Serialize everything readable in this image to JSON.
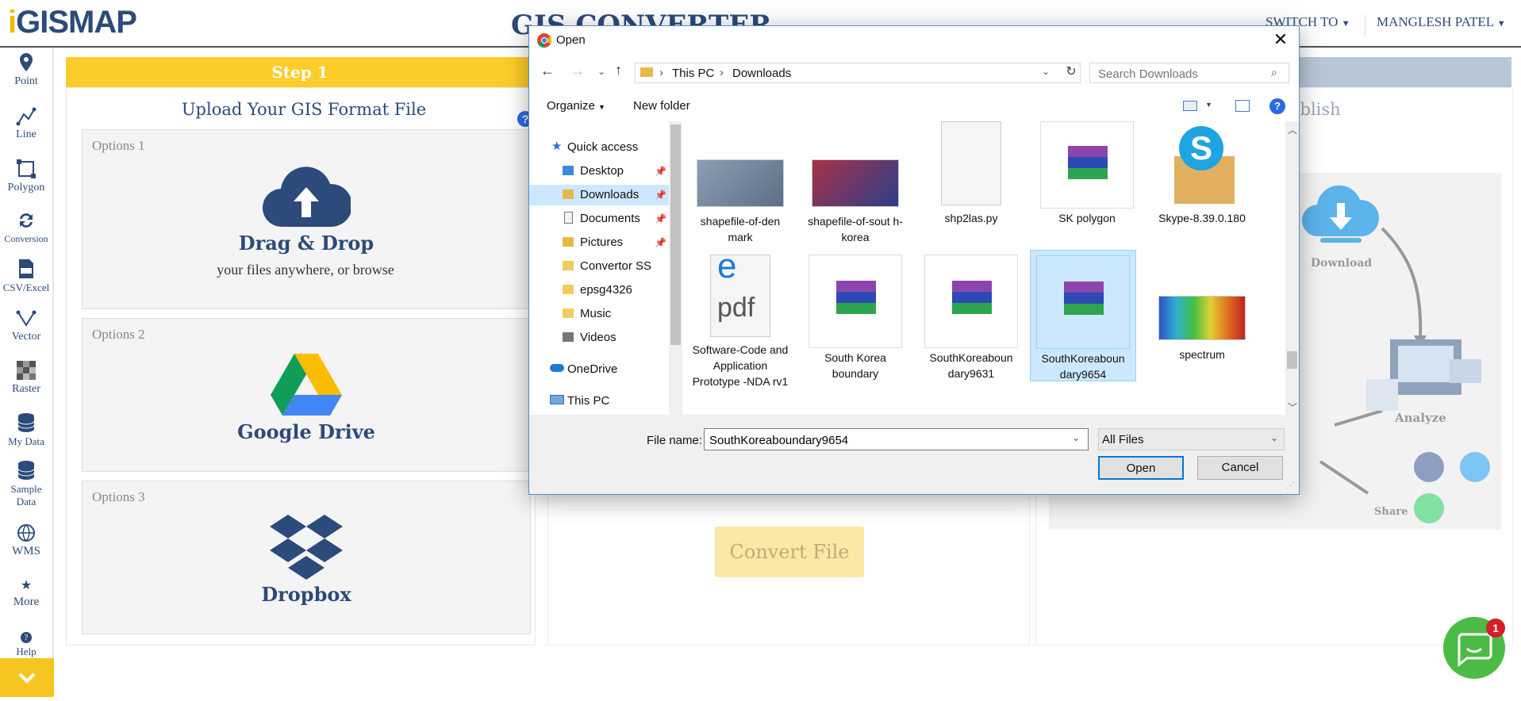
{
  "header": {
    "logo_prefix": "i",
    "logo_text": "GISMAP",
    "title": "GIS CONVERTER",
    "switch_to": "SWITCH TO",
    "user": "MANGLESH PATEL"
  },
  "sidebar": {
    "items": [
      {
        "label": "Point",
        "icon": "point-icon"
      },
      {
        "label": "Line",
        "icon": "line-icon"
      },
      {
        "label": "Polygon",
        "icon": "polygon-icon"
      },
      {
        "label": "Conversion",
        "icon": "conversion-icon"
      },
      {
        "label": "CSV/Excel",
        "icon": "csv-icon"
      },
      {
        "label": "Vector",
        "icon": "vector-icon"
      },
      {
        "label": "Raster",
        "icon": "raster-icon"
      },
      {
        "label": "My Data",
        "icon": "database-icon"
      },
      {
        "label": "Sample Data",
        "icon": "sample-data-icon"
      },
      {
        "label": "WMS",
        "icon": "wms-icon"
      },
      {
        "label": "More",
        "icon": "star-icon"
      },
      {
        "label": "Help",
        "icon": "help-icon"
      }
    ]
  },
  "main": {
    "step1_label": "Step 1",
    "upload_title": "Upload Your GIS Format File",
    "options": [
      {
        "label": "Options 1",
        "title": "Drag & Drop",
        "subtitle": "your files anywhere, or browse"
      },
      {
        "label": "Options 2",
        "title": "Google Drive"
      },
      {
        "label": "Options 3",
        "title": "Dropbox"
      }
    ],
    "publish_label": "ublish",
    "convert_button": "Convert File",
    "graphic_labels": {
      "download": "Download",
      "analyze": "Analyze",
      "share": "Share"
    }
  },
  "chat": {
    "badge": "1"
  },
  "dialog": {
    "title": "Open",
    "breadcrumb": [
      "This PC",
      "Downloads"
    ],
    "search_placeholder": "Search Downloads",
    "organize": "Organize",
    "new_folder": "New folder",
    "nav": [
      {
        "label": "Quick access",
        "icon": "star-icon"
      },
      {
        "label": "Desktop",
        "icon": "folder-icon",
        "pinned": true
      },
      {
        "label": "Downloads",
        "icon": "download-folder-icon",
        "pinned": true,
        "selected": true
      },
      {
        "label": "Documents",
        "icon": "documents-icon",
        "pinned": true
      },
      {
        "label": "Pictures",
        "icon": "pictures-icon",
        "pinned": true
      },
      {
        "label": "Convertor SS",
        "icon": "folder-icon"
      },
      {
        "label": "epsg4326",
        "icon": "folder-icon"
      },
      {
        "label": "Music",
        "icon": "music-icon"
      },
      {
        "label": "Videos",
        "icon": "videos-icon"
      },
      {
        "label": "OneDrive",
        "icon": "onedrive-icon"
      },
      {
        "label": "This PC",
        "icon": "computer-icon"
      }
    ],
    "files": [
      {
        "name": "shapefile-of-den mark",
        "kind": "image",
        "selected": false
      },
      {
        "name": "shapefile-of-sout h-korea",
        "kind": "image",
        "selected": false
      },
      {
        "name": "shp2las.py",
        "kind": "blank",
        "selected": false
      },
      {
        "name": "SK polygon",
        "kind": "archive",
        "selected": false
      },
      {
        "name": "Skype-8.39.0.180",
        "kind": "skype",
        "selected": false
      },
      {
        "name": "Software-Code and Application Prototype -NDA rv1",
        "kind": "pdf",
        "selected": false
      },
      {
        "name": "South Korea boundary",
        "kind": "archive",
        "selected": false
      },
      {
        "name": "SouthKoreaboun dary9631",
        "kind": "archive",
        "selected": false
      },
      {
        "name": "SouthKoreaboun dary9654",
        "kind": "archive",
        "selected": true
      },
      {
        "name": "spectrum",
        "kind": "spectrum",
        "selected": false
      }
    ],
    "file_name_label": "File name:",
    "file_name_value": "SouthKoreaboundary9654",
    "file_type": "All Files",
    "open_button": "Open",
    "cancel_button": "Cancel"
  },
  "colors": {
    "brand": "#2c4a7a",
    "step_yellow": "#fccd2a",
    "selection": "#cce8ff",
    "chat_green": "#4cbb45"
  }
}
